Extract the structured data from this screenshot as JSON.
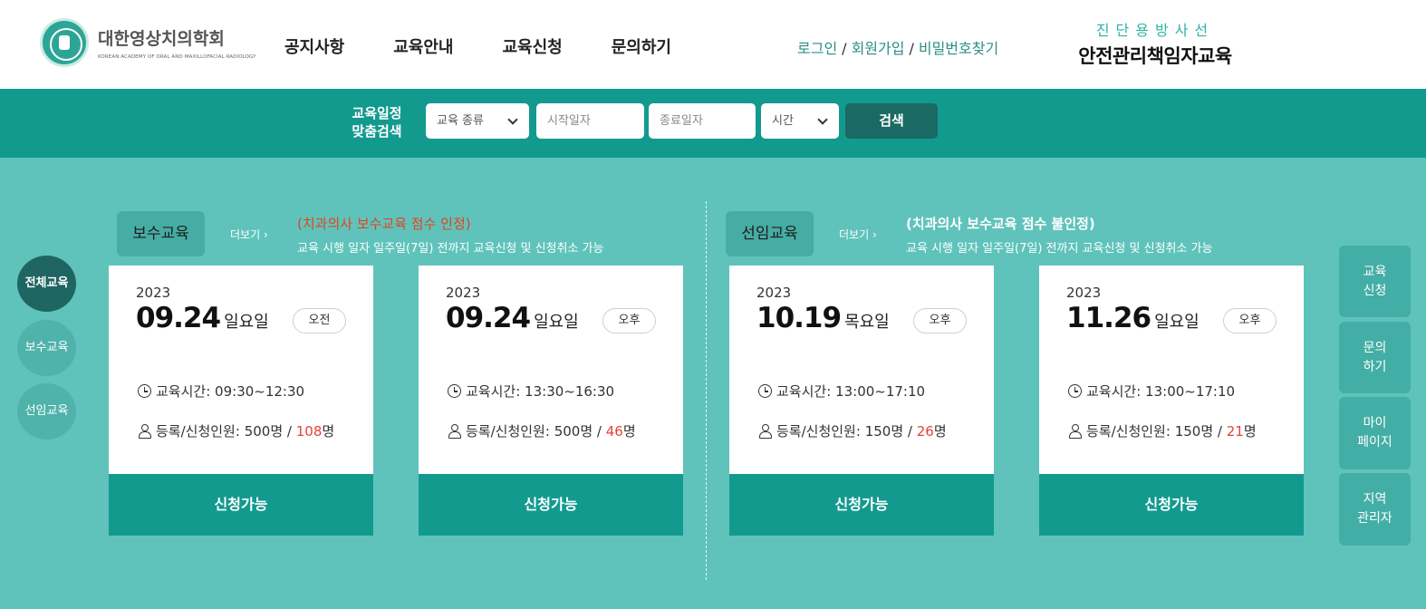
{
  "header": {
    "logo": {
      "title": "대한영상치의학회",
      "subtitle": "KOREAN ACADEMY OF ORAL AND MAXILLOFACIAL RADIOLOGY"
    },
    "nav": [
      "공지사항",
      "교육안내",
      "교육신청",
      "문의하기"
    ],
    "auth": {
      "login": "로그인",
      "signup": "회원가입",
      "find_password": "비밀번호찾기",
      "separator": "/"
    },
    "brand": {
      "top": "진단용방사선",
      "main": "안전관리책임자교육"
    }
  },
  "search": {
    "label_line1": "교육일정",
    "label_line2": "맞춤검색",
    "type_select": "교육 종류",
    "start_placeholder": "시작일자",
    "end_placeholder": "종료일자",
    "time_select": "시간",
    "button": "검색"
  },
  "filters": [
    {
      "label": "전체교육",
      "active": true
    },
    {
      "label": "보수교육",
      "active": false
    },
    {
      "label": "선임교육",
      "active": false
    }
  ],
  "sections": [
    {
      "tag": "보수교육",
      "more": "더보기",
      "note_title": "(치과의사 보수교육 점수 인정)",
      "note_sub": "교육 시행 일자 일주일(7일) 전까지 교육신청 및 신청취소 가능",
      "note_color": "#e4431d"
    },
    {
      "tag": "선임교육",
      "more": "더보기",
      "note_title": "(치과의사 보수교육 점수 불인정)",
      "note_sub": "교육 시행 일자 일주일(7일) 전까지 교육신청 및 신청취소 가능",
      "note_color": "#ffffff"
    }
  ],
  "cards": [
    {
      "year": "2023",
      "date": "09.24",
      "day": "일요일",
      "ampm": "오전",
      "time_label": "교육시간:",
      "time": "09:30~12:30",
      "capacity_label": "등록/신청인원:",
      "capacity": "500명",
      "slash": "/",
      "applied_num": "108",
      "applied_unit": "명",
      "status": "신청가능"
    },
    {
      "year": "2023",
      "date": "09.24",
      "day": "일요일",
      "ampm": "오후",
      "time_label": "교육시간:",
      "time": "13:30~16:30",
      "capacity_label": "등록/신청인원:",
      "capacity": "500명",
      "slash": "/",
      "applied_num": "46",
      "applied_unit": "명",
      "status": "신청가능"
    },
    {
      "year": "2023",
      "date": "10.19",
      "day": "목요일",
      "ampm": "오후",
      "time_label": "교육시간:",
      "time": "13:00~17:10",
      "capacity_label": "등록/신청인원:",
      "capacity": "150명",
      "slash": "/",
      "applied_num": "26",
      "applied_unit": "명",
      "status": "신청가능"
    },
    {
      "year": "2023",
      "date": "11.26",
      "day": "일요일",
      "ampm": "오후",
      "time_label": "교육시간:",
      "time": "13:00~17:10",
      "capacity_label": "등록/신청인원:",
      "capacity": "150명",
      "slash": "/",
      "applied_num": "21",
      "applied_unit": "명",
      "status": "신청가능"
    }
  ],
  "quick_menu": [
    {
      "line1": "교육",
      "line2": "신청"
    },
    {
      "line1": "문의",
      "line2": "하기"
    },
    {
      "line1": "마이",
      "line2": "페이지"
    },
    {
      "line1": "지역",
      "line2": "관리자"
    }
  ],
  "colors": {
    "accent": "#139a8f",
    "background": "#5fc3bb",
    "dark_teal": "#1a6964",
    "highlight_red": "#e5423b"
  },
  "icons": [
    "clock-icon",
    "user-icon",
    "chevron-down-icon",
    "chevron-right-icon"
  ]
}
